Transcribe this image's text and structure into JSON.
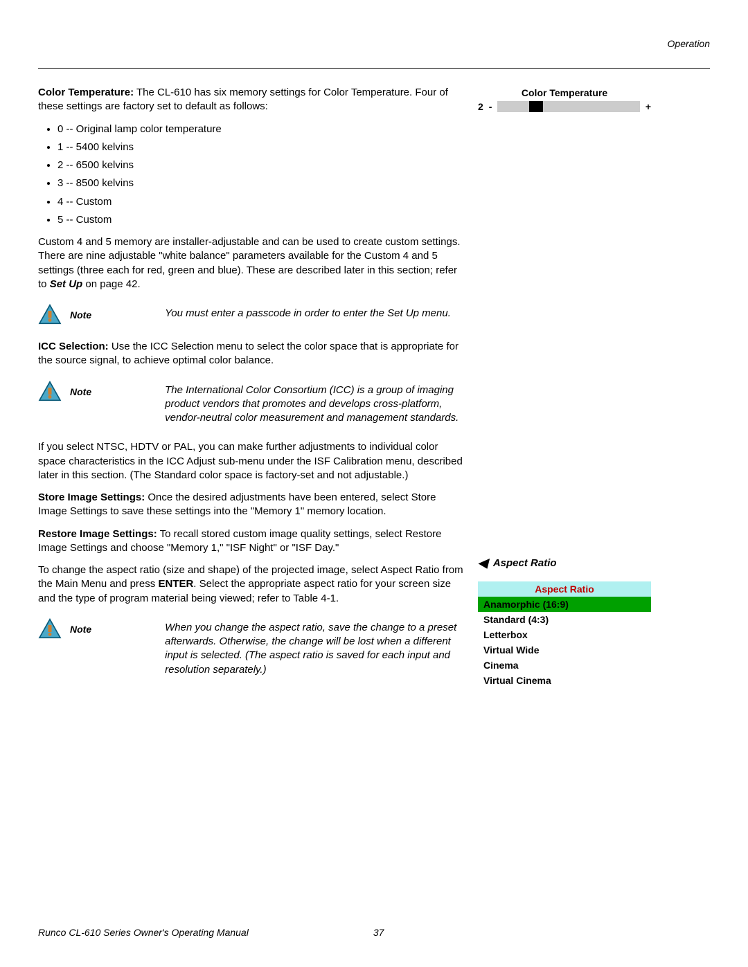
{
  "header": {
    "section": "Operation"
  },
  "colorTemp": {
    "heading": "Color Temperature:",
    "intro": " The CL-610 has six memory settings for Color Temperature. Four of these settings are factory set to default as follows:",
    "items": [
      "0 -- Original lamp color temperature",
      "1 -- 5400 kelvins",
      "2 -- 6500 kelvins",
      "3 -- 8500 kelvins",
      "4 -- Custom",
      "5 -- Custom"
    ],
    "para2a": "Custom 4 and 5 memory are installer-adjustable and can be used to create custom settings. There are nine adjustable \"white balance\" parameters available for the Custom 4 and 5 settings (three each for red, green and blue). These are described later in this section; refer to ",
    "para2b": "Set Up",
    "para2c": " on page 42.",
    "widget": {
      "title": "Color Temperature",
      "value": "2",
      "minus": "-",
      "plus": "+"
    }
  },
  "notes": {
    "label": "Note",
    "n1": "You must enter a passcode in order to enter the Set Up menu.",
    "n2": "The International Color Consortium (ICC) is a group of imaging product vendors that promotes and develops cross-platform, vendor-neutral color measurement and management standards.",
    "n3": "When you change the aspect ratio, save the change to a preset afterwards. Otherwise, the change will be lost when a different input is selected. (The aspect ratio is saved for each input and resolution separately.)"
  },
  "icc": {
    "heading": "ICC Selection:",
    "text": " Use the ICC Selection menu to select the color space that is appropriate for the source signal, to achieve optimal color balance.",
    "para2": "If you select NTSC, HDTV or PAL, you can make further adjustments to individual color space characteristics in the ICC Adjust sub-menu under the ISF Calibration menu, described later in this section. (The Standard color space is factory-set and not adjustable.)"
  },
  "store": {
    "heading": "Store Image Settings:",
    "text": " Once the desired adjustments have been entered, select Store Image Settings to save these settings into the \"Memory 1\" memory location."
  },
  "restore": {
    "heading": "Restore Image Settings:",
    "text": " To recall stored custom image quality settings, select Restore Image Settings and choose \"Memory 1,\" \"ISF Night\" or \"ISF Day.\""
  },
  "aspect": {
    "para_a": "To change the aspect ratio (size and shape) of the projected image, select Aspect Ratio from the Main Menu and press ",
    "para_b": "ENTER",
    "para_c": ". Select the appropriate aspect ratio for your screen size and the type of program material being viewed; refer to Table 4-1.",
    "heading": "Aspect Ratio",
    "menu": {
      "title": "Aspect Ratio",
      "selected": "Anamorphic (16:9)",
      "items": [
        "Standard (4:3)",
        "Letterbox",
        "Virtual Wide",
        "Cinema",
        "Virtual Cinema"
      ]
    }
  },
  "footer": {
    "text": "Runco CL-610 Series Owner's Operating Manual",
    "page": "37"
  }
}
